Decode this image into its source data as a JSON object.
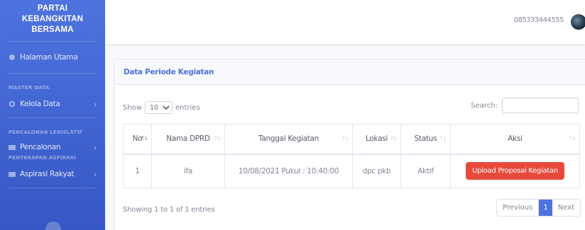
{
  "sidebar": {
    "brand": [
      "PARTAI",
      "KEBANGKITAN",
      "BERSAMA"
    ],
    "dashboard_label": "Halaman Utama",
    "heading_master": "MASTER DATA",
    "kelola_label": "Kelola Data",
    "heading_pencalonan": "PENCALONAN LEGISLATIF",
    "pencalonan_label": "Pencalonan",
    "heading_aspirasi": "PENYERAPAN ASPIRASI",
    "aspirasi_label": "Aspirasi Rakyat",
    "chevron": "›"
  },
  "topbar": {
    "user_phone": "085333444555"
  },
  "card": {
    "title": "Data Periode Kegiatan",
    "show_label": "Show",
    "entries_value": "10",
    "entries_label": "entries",
    "search_label": "Search:",
    "search_value": "",
    "columns": [
      "No",
      "Nama DPRD",
      "Tanggal Kegiatan",
      "Lokasi",
      "Status",
      "Aksi"
    ],
    "rows": [
      {
        "no": "1",
        "nama": "ifa",
        "tanggal": "10/08/2021 Pukul : 10:40:00",
        "lokasi": "dpc pkb",
        "status": "Aktif",
        "aksi": "Upload Proposal Kegiatan"
      }
    ],
    "info": "Showing 1 to 1 of 1 entries",
    "pagination": {
      "previous": "Previous",
      "current": "1",
      "next": "Next"
    }
  },
  "colors": {
    "primary": "#4e73df",
    "danger": "#e74a3b"
  }
}
